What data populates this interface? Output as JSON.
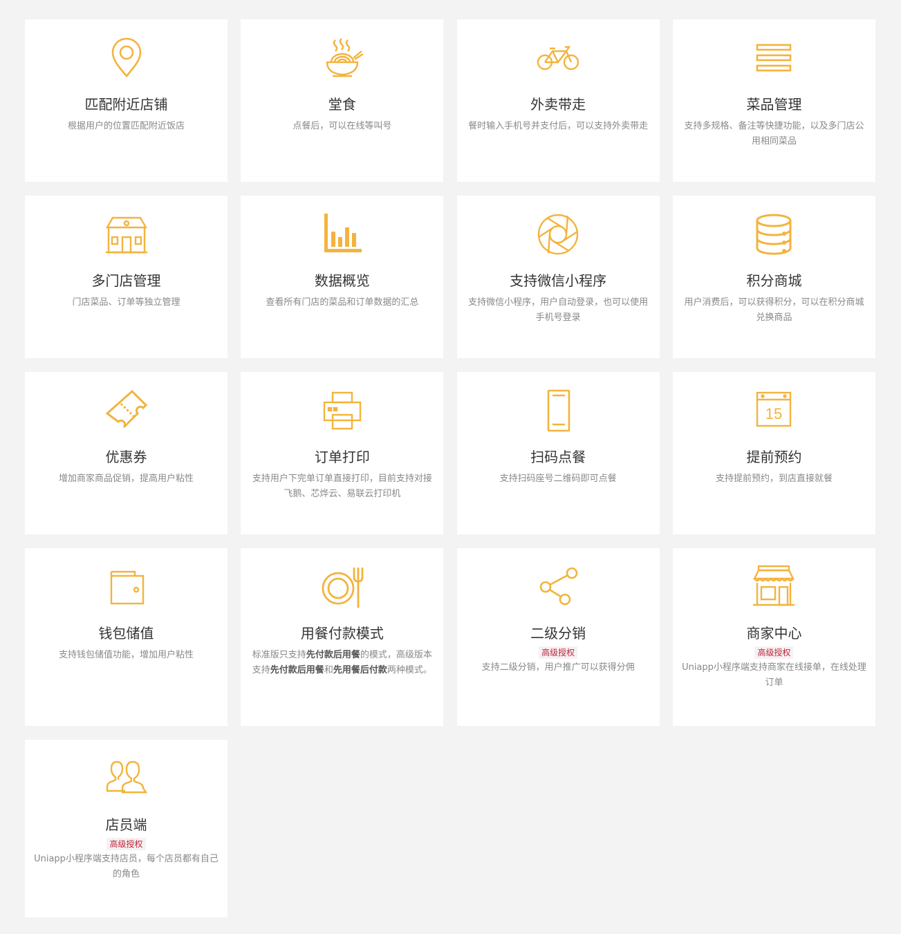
{
  "accent": "#f3b33d",
  "cards": [
    {
      "icon": "location-pin-icon",
      "title": "匹配附近店铺",
      "desc": "根据用户的位置匹配附近饭店"
    },
    {
      "icon": "noodle-bowl-icon",
      "title": "堂食",
      "desc": "点餐后，可以在线等叫号"
    },
    {
      "icon": "bicycle-icon",
      "title": "外卖带走",
      "desc": "餐时输入手机号并支付后，可以支持外卖带走"
    },
    {
      "icon": "menu-list-icon",
      "title": "菜品管理",
      "desc": "支持多规格、备注等快捷功能，以及多门店公用相同菜品"
    },
    {
      "icon": "store-building-icon",
      "title": "多门店管理",
      "desc": "门店菜品、订单等独立管理"
    },
    {
      "icon": "bar-chart-icon",
      "title": "数据概览",
      "desc": "查看所有门店的菜品和订单数据的汇总"
    },
    {
      "icon": "aperture-icon",
      "title": "支持微信小程序",
      "desc": "支持微信小程序，用户自动登录，也可以使用手机号登录"
    },
    {
      "icon": "database-coins-icon",
      "title": "积分商城",
      "desc": "用户消费后，可以获得积分，可以在积分商城兑换商品"
    },
    {
      "icon": "coupon-ticket-icon",
      "title": "优惠券",
      "desc": "增加商家商品促销，提高用户粘性"
    },
    {
      "icon": "printer-icon",
      "title": "订单打印",
      "desc": "支持用户下完单订单直接打印，目前支持对接飞鹅、芯烨云、易联云打印机"
    },
    {
      "icon": "mobile-phone-icon",
      "title": "扫码点餐",
      "desc": "支持扫码座号二维码即可点餐"
    },
    {
      "icon": "calendar-icon",
      "title": "提前预约",
      "desc": "支持提前预约，到店直接就餐",
      "calendar_day": "15"
    },
    {
      "icon": "wallet-icon",
      "title": "钱包储值",
      "desc": "支持钱包储值功能，增加用户粘性"
    },
    {
      "icon": "plate-fork-icon",
      "title": "用餐付款模式",
      "desc_parts": [
        "标准版只支持",
        "先付款后用餐",
        "的模式，高级版本支持",
        "先付款后用餐",
        "和",
        "先用餐后付款",
        "两种模式。"
      ]
    },
    {
      "icon": "share-icon",
      "title": "二级分销",
      "badge": "高级授权",
      "desc": "支持二级分销，用户推广可以获得分佣"
    },
    {
      "icon": "shopfront-icon",
      "title": "商家中心",
      "badge": "高级授权",
      "desc": "Uniapp小程序端支持商家在线接单，在线处理订单"
    },
    {
      "icon": "staff-users-icon",
      "title": "店员端",
      "badge": "高级授权",
      "desc": "Uniapp小程序端支持店员，每个店员都有自己的角色"
    }
  ]
}
